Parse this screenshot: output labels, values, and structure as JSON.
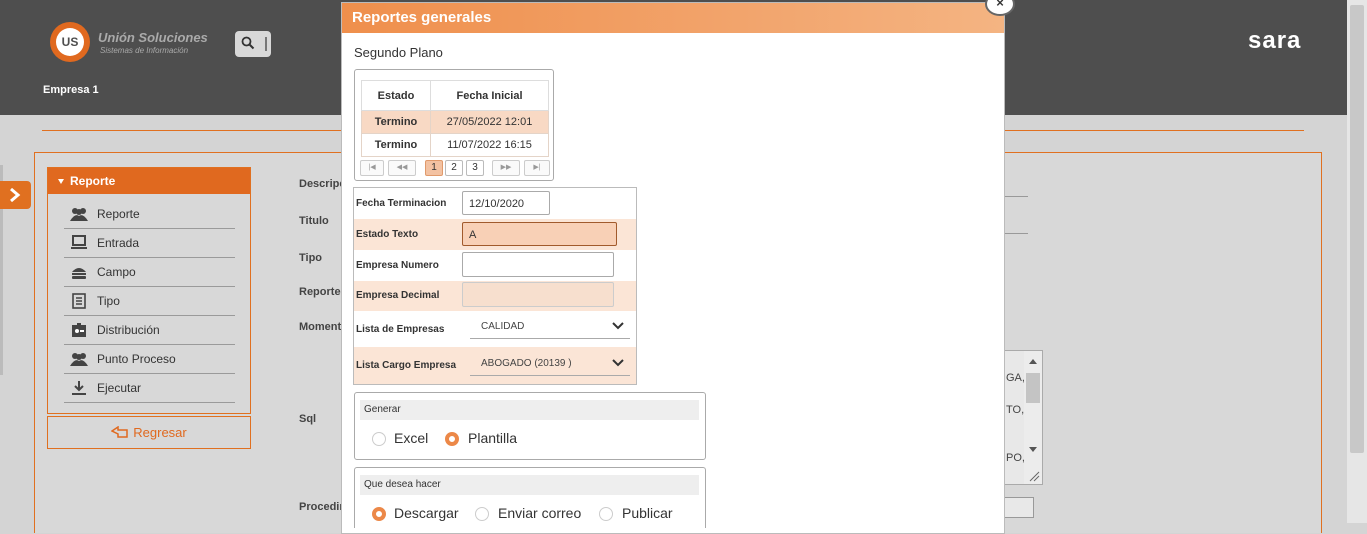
{
  "header": {
    "logo_badge": "US",
    "logo_title": "Unión Soluciones",
    "logo_subtitle": "Sistemas de Información",
    "brand": "sara",
    "company": "Empresa 1"
  },
  "menu": {
    "title": "Reporte",
    "items": [
      {
        "label": "Reporte",
        "icon": "users-icon"
      },
      {
        "label": "Entrada",
        "icon": "monitor-icon"
      },
      {
        "label": "Campo",
        "icon": "burger-icon"
      },
      {
        "label": "Tipo",
        "icon": "list-icon"
      },
      {
        "label": "Distribución",
        "icon": "id-card-icon"
      },
      {
        "label": "Punto Proceso",
        "icon": "users-icon"
      },
      {
        "label": "Ejecutar",
        "icon": "download-icon"
      }
    ],
    "back_label": "Regresar"
  },
  "fields": {
    "descripcion": "Descripc",
    "titulo": "Titulo",
    "tipo": "Tipo",
    "reporte": "Reporte",
    "momento": "Momento",
    "sql": "Sql",
    "procedimiento": "Procedim"
  },
  "sql_snippets": [
    "GA,",
    "TO,",
    "PO,"
  ],
  "modal": {
    "title": "Reportes generales",
    "subtitle": "Segundo Plano",
    "grid": {
      "columns": [
        "Estado",
        "Fecha Inicial"
      ],
      "rows": [
        {
          "estado": "Termino",
          "fecha": "27/05/2022 12:01"
        },
        {
          "estado": "Termino",
          "fecha": "11/07/2022 16:15"
        }
      ],
      "pages": [
        "1",
        "2",
        "3"
      ],
      "current_page": "1"
    },
    "form": {
      "fecha_terminacion": {
        "label": "Fecha Terminacion",
        "value": "12/10/2020"
      },
      "estado_texto": {
        "label": "Estado Texto",
        "value": "A"
      },
      "empresa_numero": {
        "label": "Empresa Numero",
        "value": ""
      },
      "empresa_decimal": {
        "label": "Empresa Decimal",
        "value": ""
      },
      "lista_empresas": {
        "label": "Lista de Empresas",
        "value": "CALIDAD"
      },
      "lista_cargo": {
        "label": "Lista Cargo Empresa",
        "value": "ABOGADO (20139 )"
      }
    },
    "generar": {
      "title": "Generar",
      "options": [
        "Excel",
        "Plantilla"
      ],
      "selected": "Plantilla"
    },
    "accion": {
      "title": "Que desea hacer",
      "options": [
        "Descargar",
        "Enviar correo",
        "Publicar"
      ],
      "selected": "Descargar"
    }
  },
  "colors": {
    "accent": "#e0691f",
    "header_bg": "#4e4e4e",
    "highlight": "#f8d9c4"
  }
}
